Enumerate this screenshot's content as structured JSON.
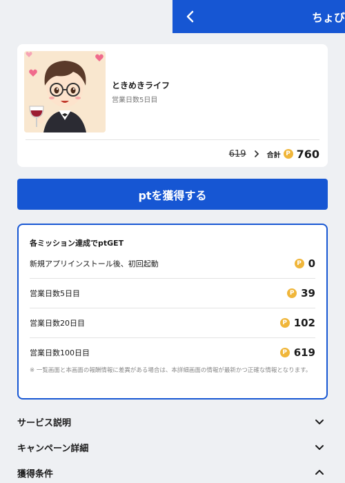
{
  "header": {
    "title": "ちょび"
  },
  "app": {
    "name": "ときめきライフ",
    "subtitle": "営業日数5日目",
    "old_points": "619",
    "total_label": "合計",
    "total_points": "760"
  },
  "get_button": {
    "label": "ptを獲得する"
  },
  "missions": {
    "title": "各ミッション達成でptGET",
    "items": [
      {
        "label": "新規アプリインストール後、初回起動",
        "points": "0"
      },
      {
        "label": "営業日数5日目",
        "points": "39"
      },
      {
        "label": "営業日数20日目",
        "points": "102"
      },
      {
        "label": "営業日数100日目",
        "points": "619"
      }
    ],
    "note": "※ 一覧画面と本画面の報酬情報に差異がある場合は、本詳細画面の情報が最新かつ正確な情報となります。"
  },
  "accordions": [
    {
      "label": "サービス説明",
      "expanded": false
    },
    {
      "label": "キャンペーン詳細",
      "expanded": false
    },
    {
      "label": "獲得条件",
      "expanded": true
    }
  ],
  "colors": {
    "primary": "#1656d3",
    "coin": "#f0b63a",
    "background": "#eef0f3"
  },
  "coin_icon_text": "P"
}
